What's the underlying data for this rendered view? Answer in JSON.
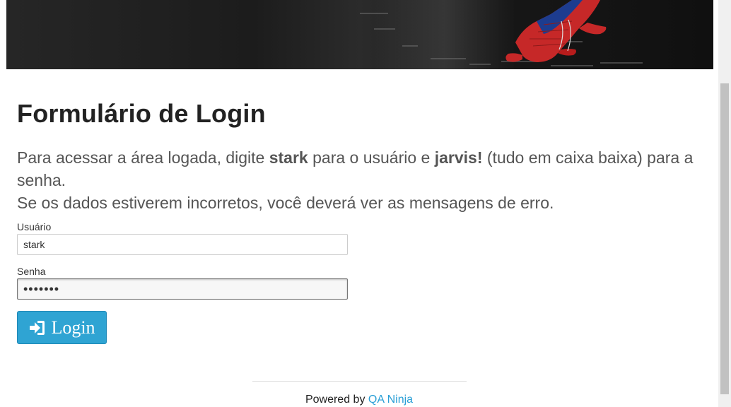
{
  "banner": {
    "image": "spider-man-banner"
  },
  "page": {
    "title": "Formulário de Login"
  },
  "intro": {
    "part1": "Para acessar a área logada, digite ",
    "user_hint": "stark",
    "part2": " para o usuário e ",
    "pass_hint": "jarvis!",
    "part3": " (tudo em caixa baixa) para a senha.",
    "line2": "Se os dados estiverem incorretos, você deverá ver as mensagens de erro."
  },
  "form": {
    "username_label": "Usuário",
    "username_value": "stark",
    "password_label": "Senha",
    "password_value": "jarvis!",
    "login_label": "Login",
    "login_icon": "sign-in-icon"
  },
  "footer": {
    "powered_by": "Powered by",
    "link_text": "QA Ninja"
  },
  "colors": {
    "accent": "#2fa4d3",
    "link": "#2a9fd6"
  }
}
